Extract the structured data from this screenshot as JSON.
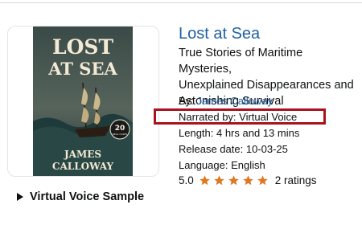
{
  "cover": {
    "title_line1": "LOST",
    "title_line2": "AT SEA",
    "badge_number": "20",
    "badge_text": "REAL CASES",
    "author_line1": "JAMES",
    "author_line2": "CALLOWAY"
  },
  "book": {
    "title": "Lost at Sea",
    "subtitle_line1": "True Stories of Maritime Mysteries,",
    "subtitle_line2": "Unexplained Disappearances and",
    "subtitle_line3": "Astonishing Survival",
    "by_label": "By: ",
    "author": "James Calloway",
    "narrated_by": "Narrated by: Virtual Voice",
    "length": "Length: 4 hrs and 13 mins",
    "release_date": "Release date: 10-03-25",
    "language": "Language: English",
    "rating_value": "5.0",
    "rating_stars": 5,
    "ratings_count": "2 ratings"
  },
  "sample": {
    "label": "Virtual Voice Sample"
  },
  "colors": {
    "link": "#2162a1",
    "star": "#de7921",
    "highlight": "#a8131d"
  }
}
